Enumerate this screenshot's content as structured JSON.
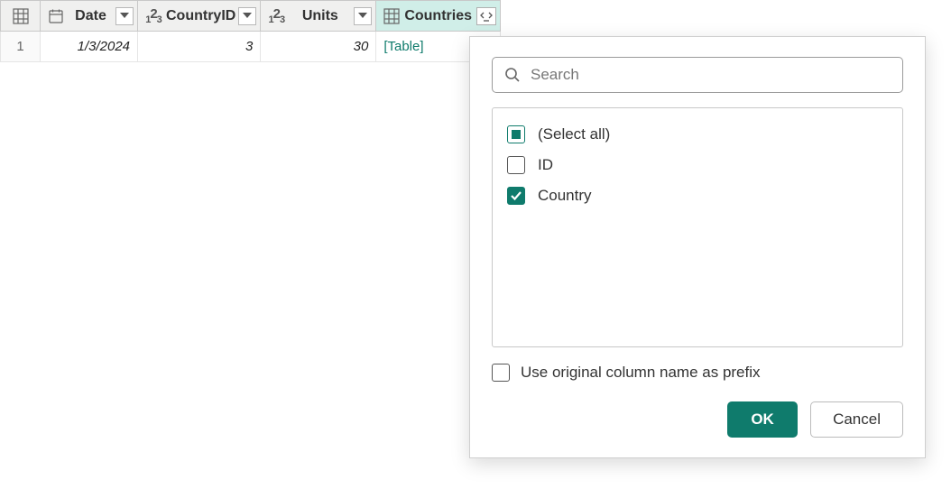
{
  "columns": [
    {
      "name": "Date",
      "type": "date"
    },
    {
      "name": "CountryID",
      "type": "number"
    },
    {
      "name": "Units",
      "type": "number"
    },
    {
      "name": "Countries",
      "type": "table",
      "highlighted": true
    }
  ],
  "rows": [
    {
      "num": "1",
      "date": "1/3/2024",
      "countryid": "3",
      "units": "30",
      "countries": "[Table]"
    }
  ],
  "popup": {
    "search_placeholder": "Search",
    "options": {
      "select_all": "(Select all)",
      "id": "ID",
      "country": "Country"
    },
    "prefix_label": "Use original column name as prefix",
    "ok_label": "OK",
    "cancel_label": "Cancel"
  },
  "colors": {
    "accent": "#0f7b6c",
    "highlight": "#d0eee8"
  }
}
